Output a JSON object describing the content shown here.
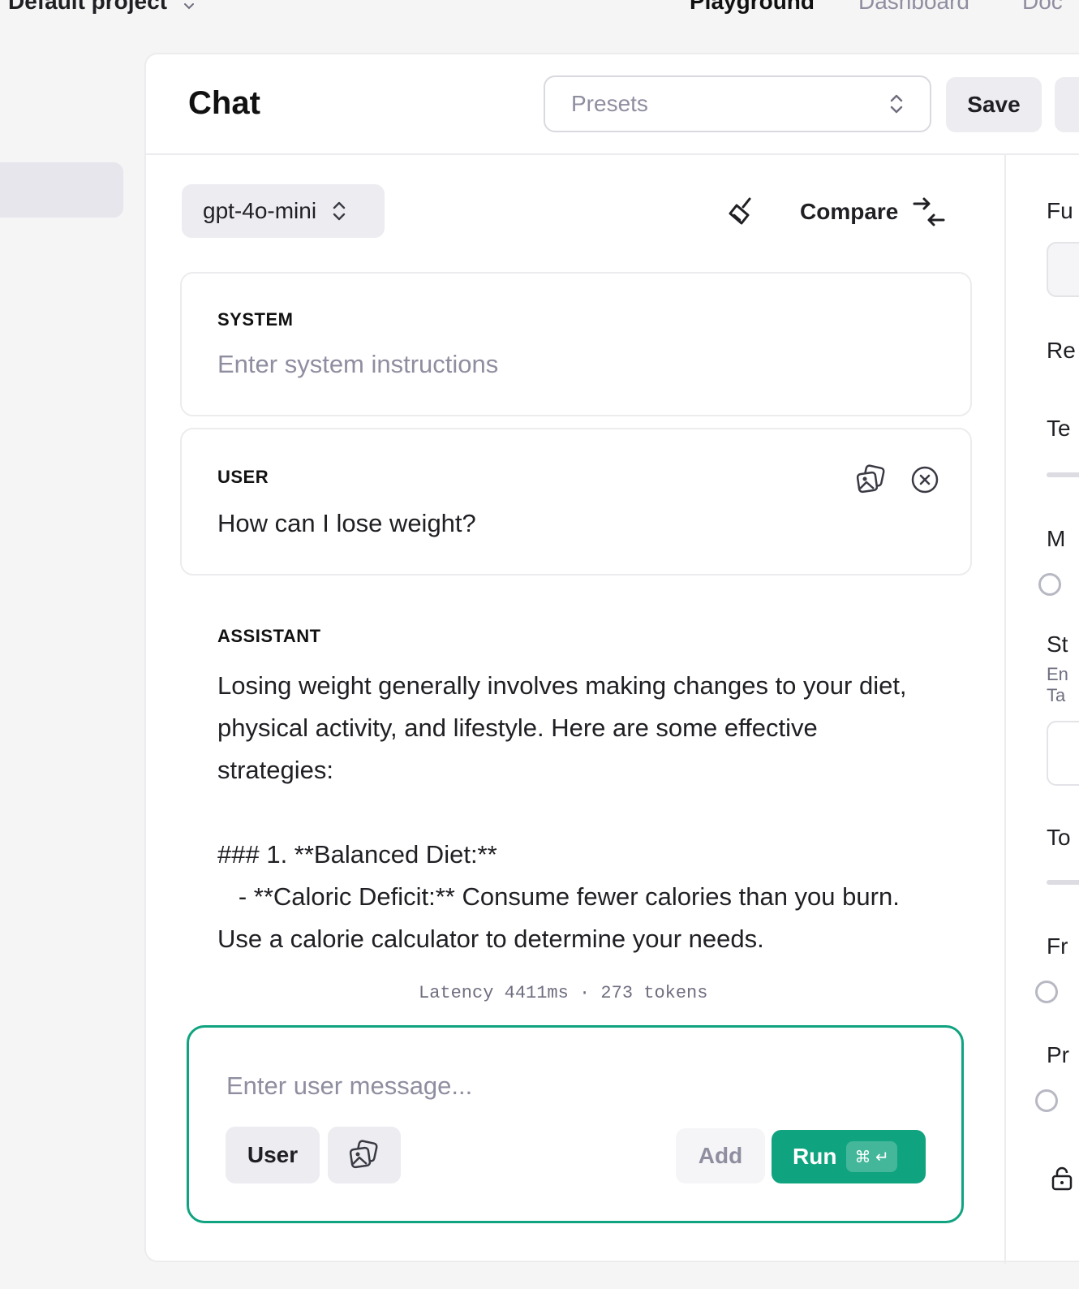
{
  "topbar": {
    "project": "Default project",
    "nav": [
      "Playground",
      "Dashboard",
      "Doc"
    ]
  },
  "header": {
    "title": "Chat",
    "presets_placeholder": "Presets",
    "save_label": "Save"
  },
  "toolbar": {
    "model": "gpt-4o-mini",
    "compare_label": "Compare",
    "clear_icon": "broom-icon",
    "compare_icon": "compare-arrows-icon"
  },
  "messages": {
    "system": {
      "role": "SYSTEM",
      "placeholder": "Enter system instructions"
    },
    "user": {
      "role": "USER",
      "text": "How can I lose weight?",
      "icons": [
        "image-icon",
        "remove-circle-icon"
      ]
    },
    "assistant": {
      "role": "ASSISTANT",
      "text": "Losing weight generally involves making changes to your diet, physical activity, and lifestyle. Here are some effective strategies:\n\n### 1. **Balanced Diet:**\n   - **Caloric Deficit:** Consume fewer calories than you burn. Use a calorie calculator to determine your needs."
    }
  },
  "stats": {
    "latency": "Latency 4411ms · 273 tokens"
  },
  "composer": {
    "placeholder": "Enter user message...",
    "role_label": "User",
    "add_label": "Add",
    "run_label": "Run",
    "shortcut": "⌘ ↵"
  },
  "right_panel": {
    "labels": [
      "Fu",
      "Re",
      "Te",
      "M",
      "St",
      "To",
      "Fr",
      "Pr"
    ],
    "hint_lines": [
      "En",
      "Ta"
    ]
  },
  "colors": {
    "accent": "#10a37f",
    "muted_text": "#8e8ea0",
    "button_bg": "#ececf1"
  }
}
